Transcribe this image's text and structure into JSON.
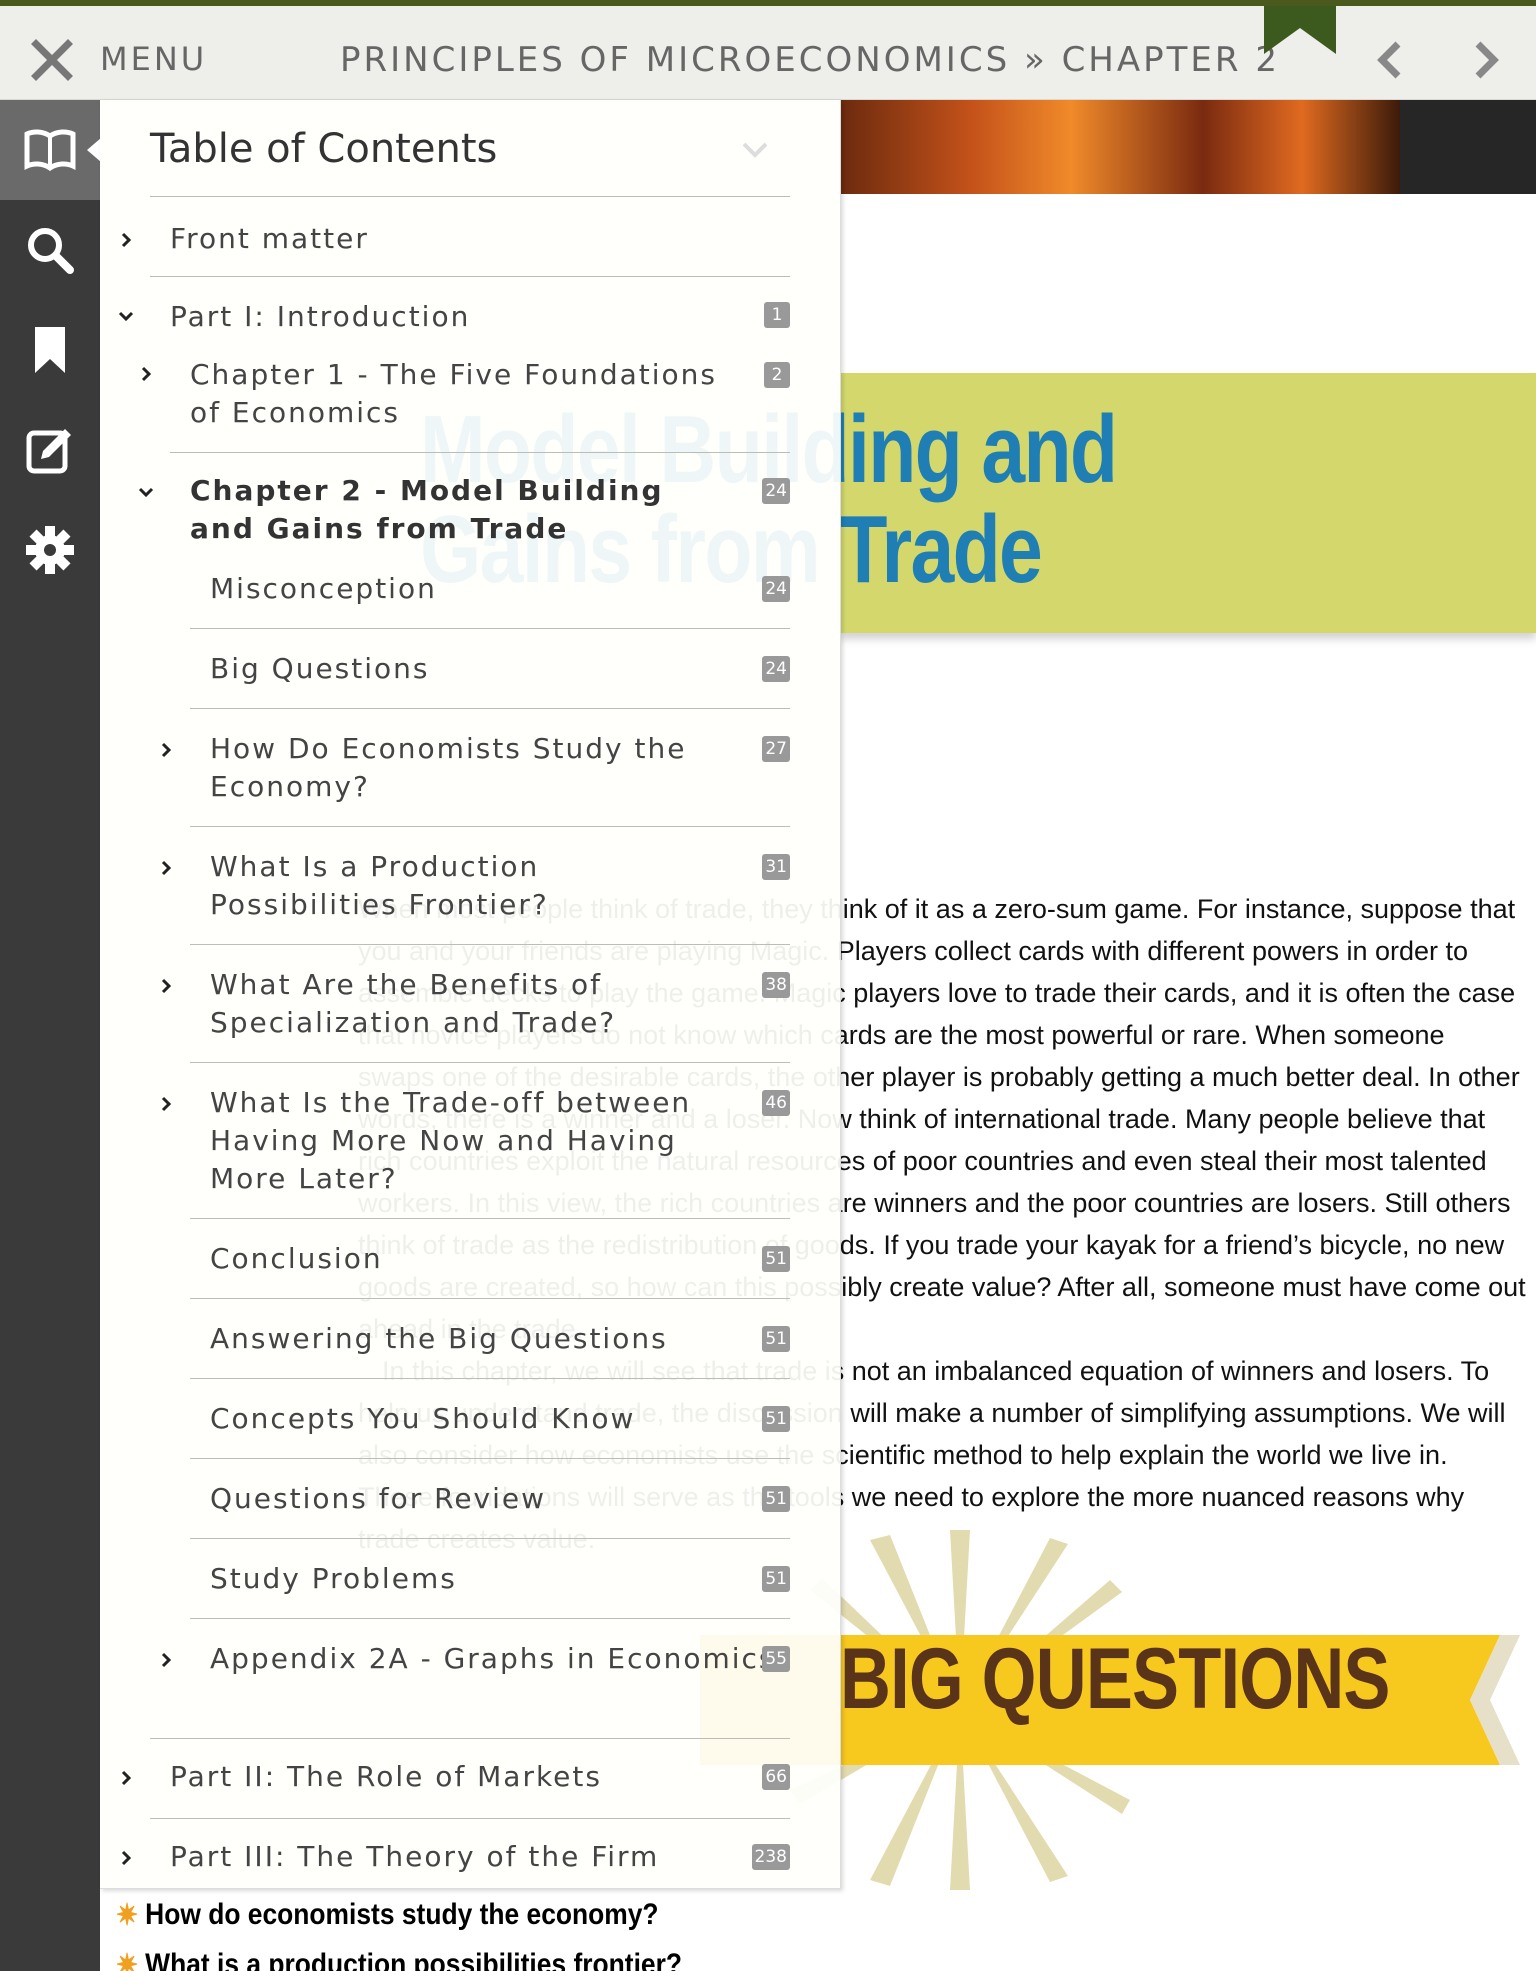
{
  "topbar": {
    "close_icon": "close-icon",
    "menu_label": "MENU",
    "book_title": "PRINCIPLES OF MICROECONOMICS » CHAPTER 2",
    "accent_color": "#4a5a1f"
  },
  "sidebar": {
    "items": [
      {
        "name": "book-icon",
        "active": true
      },
      {
        "name": "search-icon",
        "active": false
      },
      {
        "name": "bookmark-icon",
        "active": false
      },
      {
        "name": "notes-icon",
        "active": false
      },
      {
        "name": "gear-icon",
        "active": false
      }
    ]
  },
  "page": {
    "chapter_title_line1": "Model Building and",
    "chapter_title_line2": "Gains from Trade",
    "paragraph1": "When most people think of trade, they think of it as a zero-sum game. For instance, suppose that you and your friends are playing Magic. Players collect cards with different powers in order to assemble decks to play the game. Magic players love to trade their cards, and it is often the case that novice players do not know which cards are the most powerful or rare. When someone swaps one of the desirable cards, the other player is probably getting a much better deal. In other words, there is a winner and a loser. Now think of international trade. Many people believe that rich countries exploit the natural resources of poor countries and even steal their most talented workers. In this view, the rich countries are winners and the poor countries are losers. Still others think of trade as the redistribution of goods. If you trade your kayak for a friend’s bicycle, no new goods are created, so how can this possibly create value? After all, someone must have come out ahead in the trade.",
    "paragraph2": "In this chapter, we will see that trade is not an imbalanced equation of winners and losers. To help us understand trade, the discussion will make a number of simplifying assumptions. We will also consider how economists use the scientific method to help explain the world we live in. These foundations will serve as the tools we need to explore the more nuanced reasons why trade creates value.",
    "big_questions_label": "BIG QUESTIONS",
    "questions": [
      "How do economists study the economy?",
      "What is a production possibilities frontier?"
    ]
  },
  "toc": {
    "title": "Table of Contents",
    "items": [
      {
        "label": "Front matter",
        "page": ""
      },
      {
        "label": "Part I: Introduction",
        "page": "1"
      },
      {
        "label": "Chapter 1 - The Five Foundations of Economics",
        "page": "2"
      },
      {
        "label": "Chapter 2 - Model Building and Gains from Trade",
        "page": "24"
      },
      {
        "label": "Misconception",
        "page": "24"
      },
      {
        "label": "Big Questions",
        "page": "24"
      },
      {
        "label": "How Do Economists Study the Economy?",
        "page": "27"
      },
      {
        "label": "What Is a Production Possibilities Frontier?",
        "page": "31"
      },
      {
        "label": "What Are the Benefits of Specialization and Trade?",
        "page": "38"
      },
      {
        "label": "What Is the Trade-off between Having More Now and Having More Later?",
        "page": "46"
      },
      {
        "label": "Conclusion",
        "page": "51"
      },
      {
        "label": "Answering the Big Questions",
        "page": "51"
      },
      {
        "label": "Concepts You Should Know",
        "page": "51"
      },
      {
        "label": "Questions for Review",
        "page": "51"
      },
      {
        "label": "Study Problems",
        "page": "51"
      },
      {
        "label": "Appendix 2A - Graphs in Economics",
        "page": "55"
      },
      {
        "label": "Part II: The Role of Markets",
        "page": "66"
      },
      {
        "label": "Part III: The Theory of the Firm",
        "page": "238"
      }
    ]
  }
}
